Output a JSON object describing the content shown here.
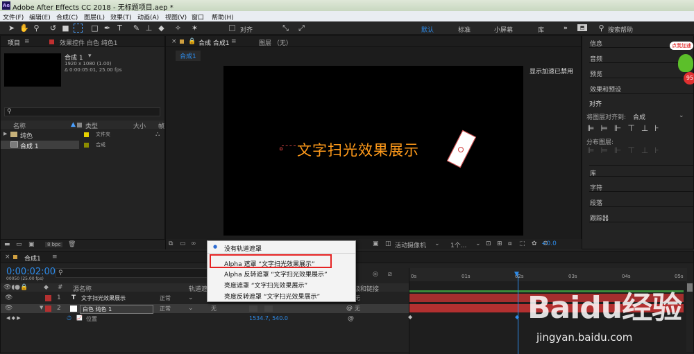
{
  "titlebar": {
    "logo": "Ae",
    "title": "Adobe After Effects CC 2018 - 无标题项目.aep *"
  },
  "menu": [
    "文件(F)",
    "编辑(E)",
    "合成(C)",
    "图层(L)",
    "效果(T)",
    "动画(A)",
    "视图(V)",
    "窗口",
    "帮助(H)"
  ],
  "toolbar": {
    "align_label": "对齐",
    "workspaces": [
      "默认",
      "标准",
      "小屏幕",
      "库"
    ],
    "search_placeholder": "搜索帮助"
  },
  "project": {
    "tab_project": "项目",
    "tab_effects": "效果控件 白色 纯色1",
    "comp_name": "合成 1",
    "comp_info1": "1920 x 1080 (1.00)",
    "comp_info2": "Δ 0:00:05:01, 25.00 fps",
    "col_name": "名称",
    "col_type": "类型",
    "col_size": "大小",
    "col_extra": "帧",
    "items": [
      {
        "name": "纯色",
        "type": "文件夹",
        "color": "#e8d200"
      },
      {
        "name": "合成 1",
        "type": "合成",
        "color": "#8c8c00"
      }
    ],
    "bpc": "8 bpc"
  },
  "viewer": {
    "tab_comp": "合成 合成1",
    "tab_layer": "图层 （无）",
    "breadcrumb": "合成1",
    "gpu_note": "显示加速已禁用",
    "comp_text": "文字扫光效果展示",
    "camera": "活动摄像机",
    "views": "1个...",
    "offset": "+0.0"
  },
  "right_panel": {
    "items_top": [
      "信息",
      "音频",
      "预览",
      "效果和预设"
    ],
    "align_title": "对齐",
    "align_to_label": "将图层对齐到:",
    "align_to_value": "合成",
    "distribute_label": "分布图层:",
    "items_bottom": [
      "库",
      "字符",
      "段落",
      "跟踪器"
    ]
  },
  "timeline": {
    "tab": "合成1",
    "timecode": "0:00:02:00",
    "timecode_sub": "00050 (25.00 fps)",
    "col_source": "源名称",
    "col_matte": "轨道遮",
    "col_parent": "父级和链接",
    "layers": [
      {
        "num": "1",
        "name": "文字扫光效果展示",
        "mode": "正常",
        "parent": "无",
        "color": "#b33030"
      },
      {
        "num": "2",
        "name": "白色 纯色 1",
        "mode": "正常",
        "matte": "无",
        "parent": "无",
        "color": "#b33030"
      }
    ],
    "prop_name": "位置",
    "prop_value": "1534.7, 540.0",
    "ruler": [
      "0s",
      "01s",
      "02s",
      "03s",
      "04s",
      "05s"
    ]
  },
  "context_menu": {
    "items": [
      "没有轨道遮罩",
      "Alpha 遮罩 “文字扫光效果展示”",
      "Alpha 反转遮罩 “文字扫光效果展示”",
      "亮度遮罩 “文字扫光效果展示”",
      "亮度反转遮罩 “文字扫光效果展示”"
    ]
  },
  "watermark": {
    "brand": "Baidu经验",
    "url": "jingyan.baidu.com",
    "badge": "点我加速",
    "badge_num": "95"
  }
}
